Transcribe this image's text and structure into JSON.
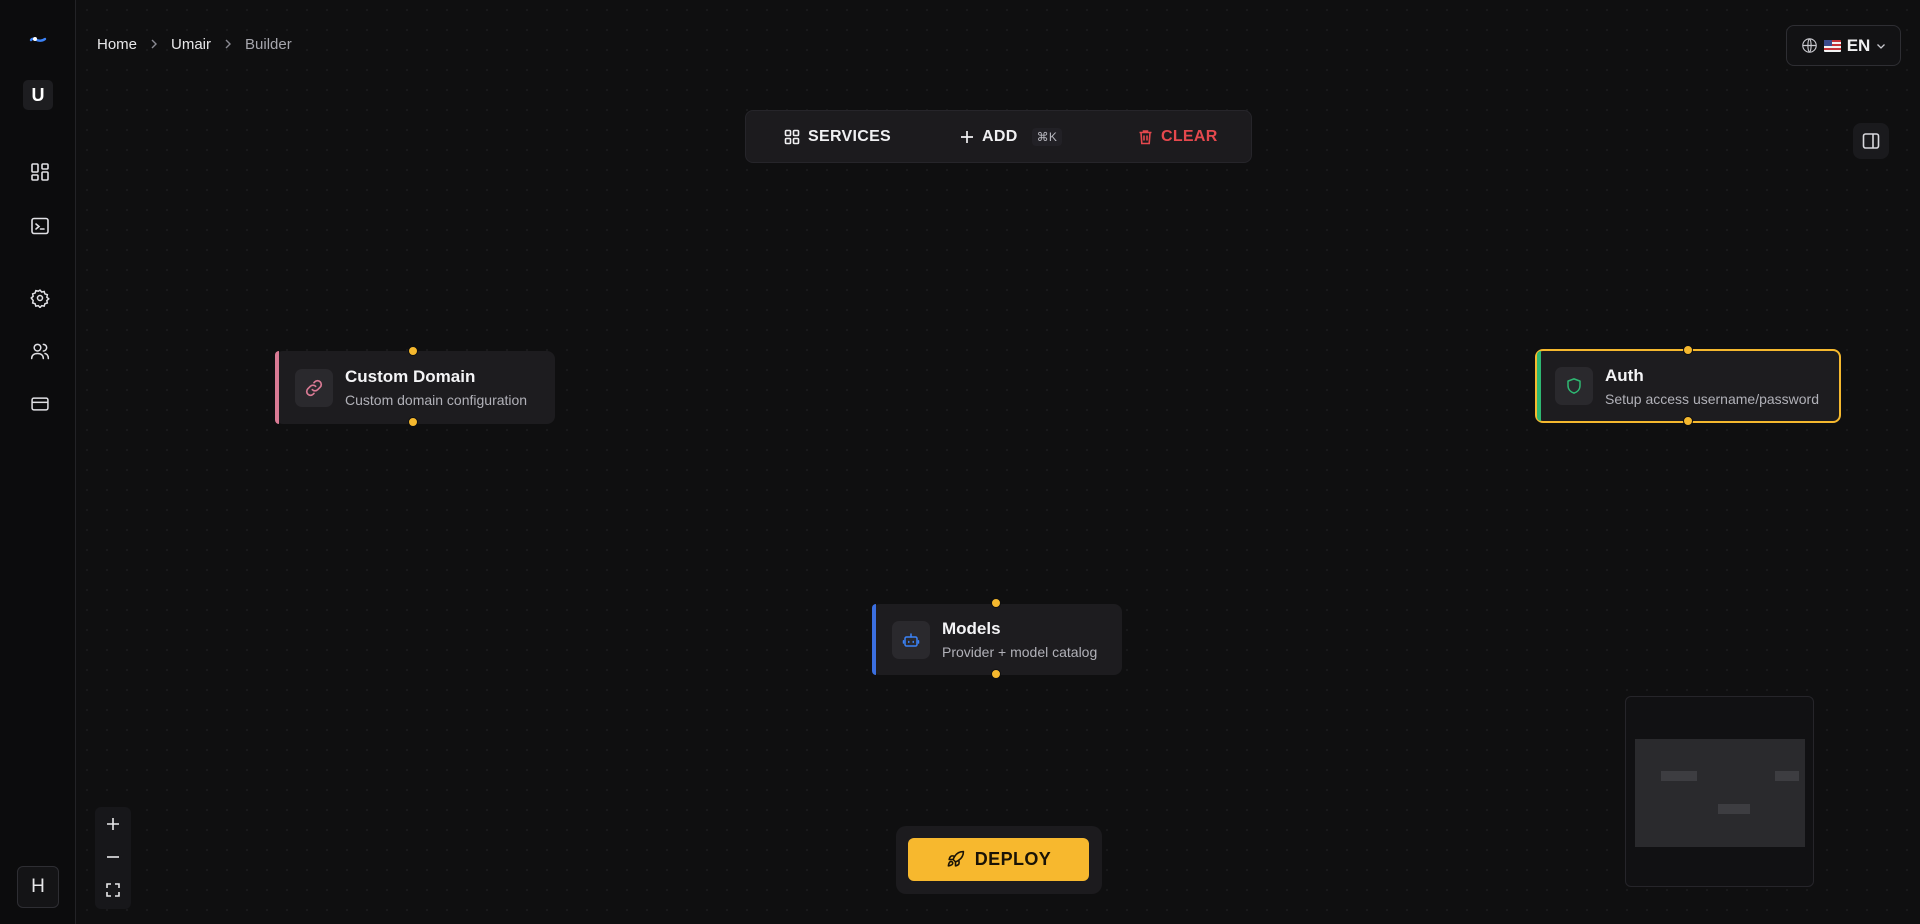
{
  "breadcrumb": {
    "items": [
      "Home",
      "Umair",
      "Builder"
    ]
  },
  "sidebar": {
    "workspace_initial": "U",
    "user_initial": "H",
    "items": [
      "dashboard-icon",
      "terminal-icon",
      "settings-icon",
      "users-icon",
      "billing-icon"
    ]
  },
  "language": {
    "label": "EN"
  },
  "toolbar": {
    "services_label": "SERVICES",
    "add_label": "ADD",
    "add_shortcut": "⌘K",
    "clear_label": "CLEAR"
  },
  "nodes": {
    "domain": {
      "title": "Custom Domain",
      "description": "Custom domain configuration",
      "accent": "#d97a94"
    },
    "models": {
      "title": "Models",
      "description": "Provider + model catalog",
      "accent": "#3b6fe0"
    },
    "auth": {
      "title": "Auth",
      "description": "Setup access username/password",
      "accent": "#2eb872",
      "selected": true
    }
  },
  "zoom": {
    "in": "+",
    "out": "—"
  },
  "deploy": {
    "label": "DEPLOY",
    "color": "#f7b82e"
  }
}
